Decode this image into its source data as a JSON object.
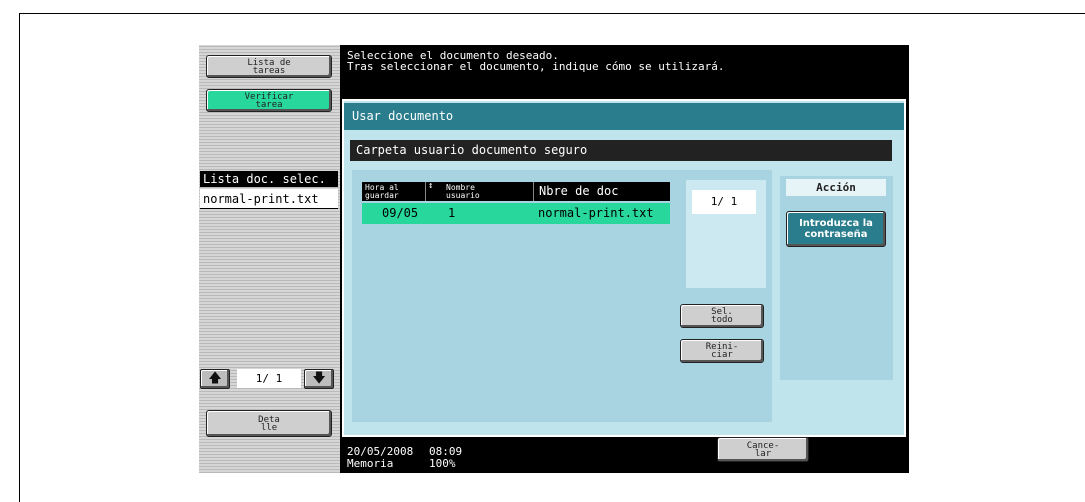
{
  "sidebar": {
    "job_list_button": "Lista de\ntareas",
    "check_job_button": "Verificar\ntarea",
    "selected_list_title": "Lista doc. selec.",
    "selected_items": [
      "normal-print.txt"
    ],
    "pager_text": "1/  1",
    "detail_button": "Deta\nlle"
  },
  "message": {
    "line1": "Seleccione el documento deseado.",
    "line2": "Tras seleccionar el documento, indique cómo se utilizará."
  },
  "dialog": {
    "title": "Usar documento",
    "folder_title": "Carpeta usuario documento seguro",
    "table": {
      "headers": [
        "Hora al\nguardar",
        "Nombre\nusuario",
        "Nbre de doc"
      ],
      "rows": [
        {
          "time": "09/05",
          "user": "1",
          "doc": "normal-print.txt"
        }
      ]
    },
    "page_text": "1/  1",
    "select_all_button": "Sel.\ntodo",
    "reset_button": "Reini-\nciar",
    "action_label": "Acción",
    "password_button": "Introduzca la\ncontraseña"
  },
  "footer": {
    "date": "20/05/2008",
    "time": "08:09",
    "memory_label": "Memoria",
    "memory_value": "100%",
    "cancel_button": "Cance-\nlar"
  },
  "colors": {
    "accent_green": "#27d79b",
    "title_teal": "#2a7d8c",
    "panel_blue": "#bfe4ec"
  }
}
